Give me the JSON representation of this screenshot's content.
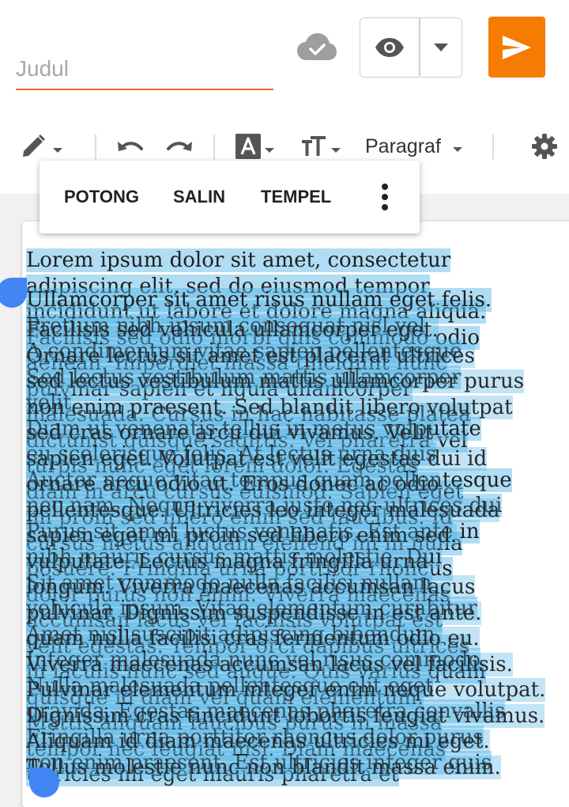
{
  "header": {
    "title_placeholder": "Judul",
    "cloud_icon": "cloud-check-icon",
    "preview_icon": "eye-icon",
    "preview_dropdown_icon": "caret-down-icon",
    "publish_icon": "send-icon"
  },
  "toolbar": {
    "paragraph_label": "Paragraf"
  },
  "context_menu": {
    "cut": "POTONG",
    "copy": "SALIN",
    "paste": "TEMPEL",
    "more_icon": "more-vert-icon"
  },
  "editor": {
    "layer1": [
      "Lorem ipsum dolor sit amet, consectetur",
      "adipiscing elit, sed do eiusmod tempor",
      "incididunt ut labore et dolore magna aliqua.",
      "Facilisis sed odio morbi quis commodo odio",
      "aenean. Imperdiet massa tincidunt nunc",
      "pulvinar sapien et ligula ullamcorper",
      "malesuada. Cursus in hac habitasse platea",
      "dictumst quisque sagittis. Vel pharetra vel",
      "turpis nunc eget lorem dolor. Egestas",
      "diam in arcu cursus euismod. Sapien eget",
      "mi proin sed libero enim sed faucibus. Id",
      "cursus metus aliquam eleifend mi in nulla",
      "posuere. Fringilla urna porttitor rhoncus",
      "dolor purus non enim. Viverra maecenas",
      "accumsan lacus vel facilisis volutpat est",
      "velit egestas. Tempor orci dapibus ultrices",
      "in iaculis nunc sed augue. Quis varius quam",
      "quisque id diam vel quam elementum.",
      "Mattis aliquam faucibus purus in massa",
      "tempor nec feugiat nisl. Diam maecenas",
      "ultricies mi eget mauris pharetra et"
    ],
    "layer2": [
      "Ullamcorper sit amet risus nullam eget felis.",
      "Pretium nibh ipsum consequat nisl vel",
      "A condimentum vitae sapien pellentesque",
      "Sed lectus vestibulum mattis ullamcorper",
      "velit",
      "Diam ut venenatis tellus in metus vulputate",
      "eu scelerisque felis. At lectus urna duis",
      "Auctor neque vitae tempus quam pellentesque",
      "nec nam. Neque viverra justo nec ultrices dui",
      "Purus sit amet luctus venenatis. Est ante in",
      "nibh mauris cursus mattis molestie. Dui",
      "Sit amet commodo nulla facilisi nullam",
      "vehicula ipsum. Vitae elementum curabitur",
      "Amet nisl suscipit adipiscing bibendum.",
      "Integer malesuada nunc vel risus commodo",
      "Nulla malesuada pellentesque elit eget",
      "gravida. Egestas maecenas pharetra convallis",
      "Fringilla urna porttitor rhoncus dolor purus",
      "non enim praesent. Est ultricies integer quis"
    ],
    "layer3": [
      "Facilisis sed vehicula ullamcorper eget.",
      "Ornare lectus sit amet est placerat ultrices",
      "sed lectus vestibulum mattis ullamcorper purus",
      "non enim praesent. Sed blandit libero volutpat",
      "sed cras ornare arcu dui vivamus. Velit",
      "sapien eget. Volutpat est velit egestas dui id",
      "ornare arcu odio ut. Eros donec ac odio",
      "pellentesque. Ultricies leo integer malesuada",
      "sapien eget mi proin sed libero enim sed.",
      "vulputate. Lectus magna fringilla urna",
      "longum. Viverra maecenas accumsan lacus",
      "pulvinar. Dignissim suspendisse in est ante.",
      "quam nulla facilisi cras fermentum odio eu.",
      "Viverra maecenas accumsan lacus vel facilisis.",
      "Pulvinar elementum integer enim neque volutpat.",
      "Dignissim cras tincidunt lobortis feugiat vivamus.",
      "Aliquam id diam maecenas ultricies mi eget.",
      "Tellus molestie nunc non blandit massa enim."
    ]
  },
  "colors": {
    "accent_orange": "#f57c00",
    "underline_orange": "#f36c21",
    "selection_blue": "#4fb3e6",
    "handle_blue": "#4285f4"
  }
}
